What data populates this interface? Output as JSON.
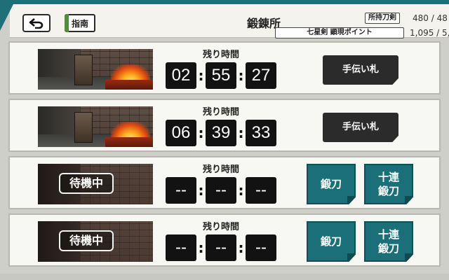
{
  "header": {
    "title": "鍛錬所",
    "guide_label": "指南",
    "owned_swords_label": "所持刀剣",
    "owned_swords_value": "480 / 48",
    "star_point_label": "七星剣 顕現ポイント",
    "star_point_value": "1,095 / 5,0"
  },
  "icons": {
    "back": "back-arrow-icon"
  },
  "colors": {
    "teal": "#1a6f78",
    "panel": "#f7f7f3",
    "timer_box": "#121212",
    "help_button": "#2b2b2b"
  },
  "slots": [
    {
      "time_label": "残り時間",
      "hours": "02",
      "minutes": "55",
      "seconds": "27",
      "help_label": "手伝い札"
    },
    {
      "time_label": "残り時間",
      "hours": "06",
      "minutes": "39",
      "seconds": "33",
      "help_label": "手伝い札"
    },
    {
      "time_label": "残り時間",
      "status": "待機中",
      "hours": "--",
      "minutes": "--",
      "seconds": "--",
      "forge_label": "鍛刀",
      "forge_ten_label_line1": "十連",
      "forge_ten_label_line2": "鍛刀"
    },
    {
      "time_label": "残り時間",
      "status": "待機中",
      "hours": "--",
      "minutes": "--",
      "seconds": "--",
      "forge_label": "鍛刀",
      "forge_ten_label_line1": "十連",
      "forge_ten_label_line2": "鍛刀"
    }
  ]
}
